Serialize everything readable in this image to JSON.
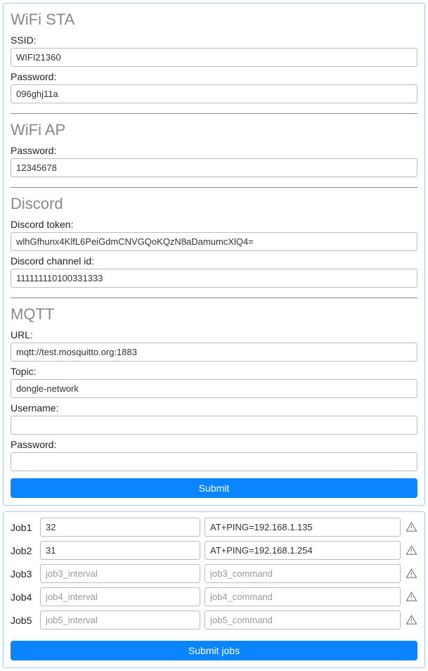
{
  "config": {
    "wifi_sta": {
      "heading": "WiFi STA",
      "ssid_label": "SSID:",
      "ssid_value": "WIFI21360",
      "password_label": "Password:",
      "password_value": "096ghj11a"
    },
    "wifi_ap": {
      "heading": "WiFi AP",
      "password_label": "Password:",
      "password_value": "12345678"
    },
    "discord": {
      "heading": "Discord",
      "token_label": "Discord token:",
      "token_value": "wlhGfhunx4KlfL6PeiGdmCNVGQoKQzN8aDamumcXlQ4=",
      "channel_label": "Discord channel id:",
      "channel_value": "111111110100331333"
    },
    "mqtt": {
      "heading": "MQTT",
      "url_label": "URL:",
      "url_value": "mqtt://test.mosquitto.org:1883",
      "topic_label": "Topic:",
      "topic_value": "dongle-network",
      "username_label": "Username:",
      "username_value": "",
      "password_label": "Password:",
      "password_value": ""
    },
    "submit_label": "Submit"
  },
  "jobs": {
    "rows": [
      {
        "label": "Job1",
        "interval_val": "32",
        "interval_ph": "",
        "command_val": "AT+PING=192.168.1.135",
        "command_ph": ""
      },
      {
        "label": "Job2",
        "interval_val": "31",
        "interval_ph": "",
        "command_val": "AT+PING=192.168.1.254",
        "command_ph": ""
      },
      {
        "label": "Job3",
        "interval_val": "",
        "interval_ph": "job3_interval",
        "command_val": "",
        "command_ph": "job3_command"
      },
      {
        "label": "Job4",
        "interval_val": "",
        "interval_ph": "job4_interval",
        "command_val": "",
        "command_ph": "job4_command"
      },
      {
        "label": "Job5",
        "interval_val": "",
        "interval_ph": "job5_interval",
        "command_val": "",
        "command_ph": "job5_command"
      }
    ],
    "submit_label": "Submit jobs"
  }
}
